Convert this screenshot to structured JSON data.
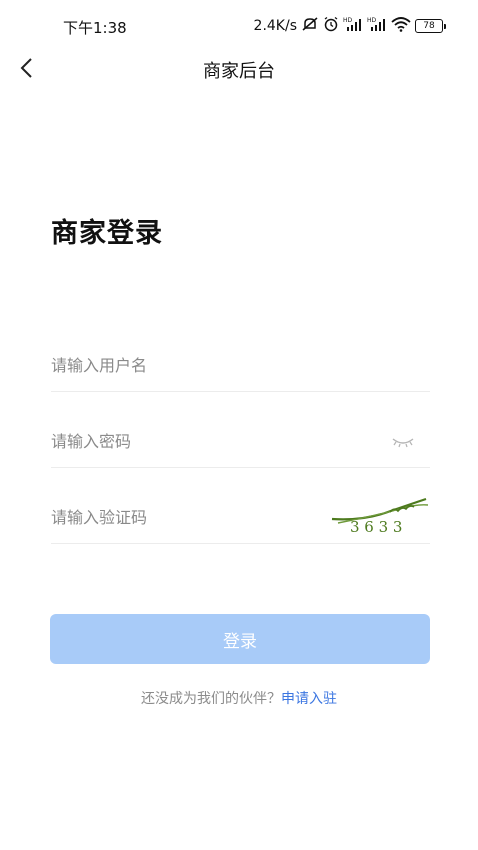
{
  "status_bar": {
    "time": "下午1:38",
    "network_speed": "2.4K/s",
    "battery_level": "78",
    "icons": [
      "mute-icon",
      "alarm-icon",
      "signal-hd-icon",
      "signal-hd-icon",
      "wifi-icon",
      "battery-icon"
    ]
  },
  "nav": {
    "title": "商家后台",
    "back_icon": "chevron-left-icon"
  },
  "login": {
    "heading": "商家登录",
    "username_placeholder": "请输入用户名",
    "password_placeholder": "请输入密码",
    "captcha_placeholder": "请输入验证码",
    "captcha_text": "3 6 3 3",
    "submit_label": "登录",
    "signup_prompt": "还没成为我们的伙伴？",
    "signup_link": "申请入驻"
  },
  "colors": {
    "button_disabled": "#a8cbf8",
    "link": "#3b76e1",
    "captcha": "#4d7a1e"
  }
}
